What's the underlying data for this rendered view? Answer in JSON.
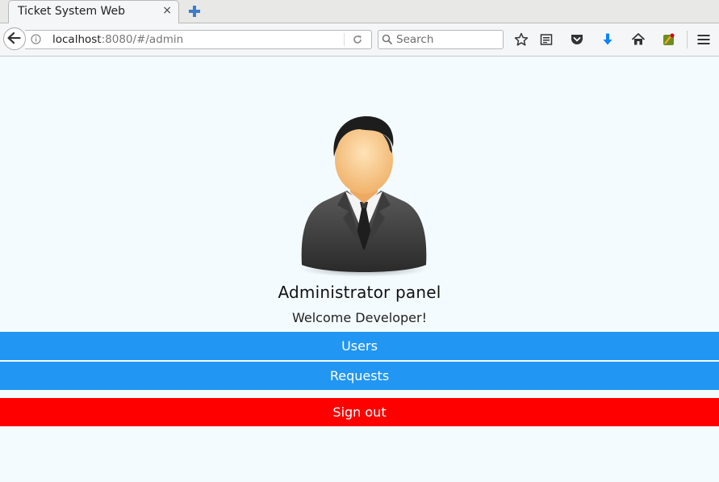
{
  "browser": {
    "tab_title": "Ticket System Web",
    "tab_close": "×",
    "url_host": "localhost",
    "url_rest": ":8080/#/admin",
    "search_placeholder": "Search"
  },
  "icons": {
    "back": "back-arrow-icon",
    "info": "info-icon",
    "reload": "reload-icon",
    "search": "search-icon",
    "bookmark": "star-icon",
    "reader": "reading-list-icon",
    "pocket": "pocket-icon",
    "download": "download-icon",
    "home": "home-icon",
    "addon": "extension-icon",
    "menu": "hamburger-menu-icon"
  },
  "admin": {
    "title": "Administrator panel",
    "welcome": "Welcome Developer!"
  },
  "menu": {
    "users": "Users",
    "requests": "Requests",
    "signout": "Sign out"
  },
  "colors": {
    "background": "#f4fbff",
    "primary_button": "#2196f3",
    "danger_button": "#ff0000"
  }
}
